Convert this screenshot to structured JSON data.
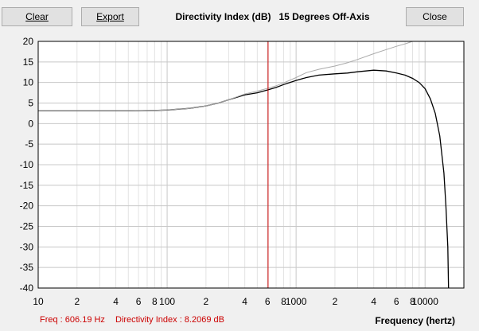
{
  "toolbar": {
    "clear_label": "Clear",
    "export_label": "Export",
    "close_label": "Close"
  },
  "title": "Directivity Index (dB)   15 Degrees Off-Axis",
  "status": {
    "freq": "Freq : 606.19 Hz",
    "di": "Directivity Index : 8.2069 dB"
  },
  "chart_data": {
    "type": "line",
    "xscale": "log",
    "xlim": [
      10,
      20000
    ],
    "ylim": [
      -40,
      20
    ],
    "grid": true,
    "xlabel": "Frequency (hertz)",
    "ylabel": "",
    "y_ticks": [
      20,
      15,
      10,
      5,
      0,
      -5,
      -10,
      -15,
      -20,
      -25,
      -30,
      -35,
      -40
    ],
    "x_ticks": [
      {
        "value": 10,
        "label": "10"
      },
      {
        "value": 20,
        "label": "2"
      },
      {
        "value": 40,
        "label": "4"
      },
      {
        "value": 60,
        "label": "6"
      },
      {
        "value": 80,
        "label": "8"
      },
      {
        "value": 100,
        "label": "100"
      },
      {
        "value": 200,
        "label": "2"
      },
      {
        "value": 400,
        "label": "4"
      },
      {
        "value": 600,
        "label": "6"
      },
      {
        "value": 800,
        "label": "8"
      },
      {
        "value": 1000,
        "label": "1000"
      },
      {
        "value": 2000,
        "label": "2"
      },
      {
        "value": 4000,
        "label": "4"
      },
      {
        "value": 6000,
        "label": "6"
      },
      {
        "value": 8000,
        "label": "8"
      },
      {
        "value": 10000,
        "label": "10000"
      }
    ],
    "cursor": {
      "x": 606.19,
      "color": "#cc0000"
    },
    "series": [
      {
        "color": "#000000",
        "x": [
          10,
          20,
          50,
          80,
          100,
          150,
          200,
          250,
          300,
          400,
          500,
          606.19,
          700,
          800,
          1000,
          1200,
          1500,
          2000,
          2500,
          3000,
          4000,
          5000,
          6000,
          7000,
          8000,
          9000,
          10000,
          11000,
          12000,
          13000,
          14000,
          14500,
          15000,
          15200
        ],
        "y": [
          3.1,
          3.1,
          3.1,
          3.2,
          3.3,
          3.7,
          4.3,
          5.0,
          5.8,
          7.0,
          7.5,
          8.2069,
          8.8,
          9.5,
          10.5,
          11.2,
          11.8,
          12.1,
          12.3,
          12.6,
          13.0,
          12.8,
          12.3,
          11.8,
          11.0,
          10.0,
          8.5,
          6.0,
          2.5,
          -3.0,
          -12.0,
          -20.0,
          -30.0,
          -40.0
        ]
      },
      {
        "color": "#aaaaaa",
        "x": [
          10,
          20,
          50,
          80,
          100,
          150,
          200,
          250,
          300,
          400,
          500,
          606.19,
          700,
          800,
          1000,
          1200,
          1500,
          2000,
          2500,
          3000,
          4000,
          5000,
          6000,
          7000,
          8000
        ],
        "y": [
          3.1,
          3.1,
          3.1,
          3.2,
          3.3,
          3.7,
          4.3,
          5.0,
          5.8,
          7.2,
          7.9,
          8.6,
          9.2,
          9.9,
          11.2,
          12.4,
          13.2,
          14.0,
          14.8,
          15.6,
          17.0,
          18.0,
          18.8,
          19.4,
          20.0
        ]
      }
    ]
  }
}
